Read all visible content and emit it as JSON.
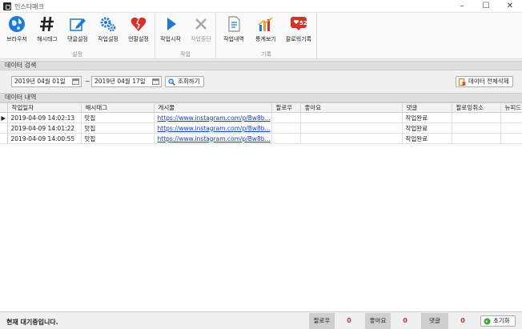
{
  "window": {
    "title": "인스타매크",
    "minimize": "–",
    "maximize": "☐",
    "close": "✕"
  },
  "ribbon": {
    "groups": [
      {
        "label": "설정",
        "buttons": [
          "브라우저",
          "해시태그",
          "댓글설정",
          "작업설정",
          "언팔설정"
        ]
      },
      {
        "label": "작업",
        "buttons": [
          "작업시작",
          "작업중단"
        ]
      },
      {
        "label": "기록",
        "buttons": [
          "작업내역",
          "통계보기",
          "팔로워기록"
        ]
      }
    ],
    "follower_badge": "52"
  },
  "search": {
    "title": "데이터 검색",
    "start_date": "2019년 04월 01일",
    "end_date": "2019년 04월 17일",
    "separator": "~",
    "search_button": "조회하기",
    "delete_all_button": "데이터 전체삭제"
  },
  "history": {
    "title": "데이터 내역",
    "columns": [
      "작업일자",
      "해시태그",
      "게시물",
      "팔로우",
      "좋아요",
      "댓글",
      "팔로잉취소",
      "뉴피드좋아요"
    ],
    "rows": [
      [
        "2019-04-09 14:02:13",
        "맛집",
        "https://www.instagram.com/p/Bw8b...",
        "",
        "",
        "작업완료",
        "",
        ""
      ],
      [
        "2019-04-09 14:01:22",
        "맛집",
        "https://www.instagram.com/p/Bw8b...",
        "",
        "",
        "작업완료",
        "",
        ""
      ],
      [
        "2019-04-09 14:00:55",
        "맛집",
        "https://www.instagram.com/p/Bw8b...",
        "",
        "",
        "작업완료",
        "",
        ""
      ]
    ],
    "current_row_marker": "▶"
  },
  "status": {
    "message": "현재 대기중입니다.",
    "follow_label": "팔로우",
    "follow_count": "0",
    "like_label": "좋아요",
    "like_count": "0",
    "comment_label": "댓글",
    "comment_count": "0",
    "reset_button": "초기화"
  },
  "colors": {
    "accent_blue": "#1f7ad1",
    "heart_red": "#d9302b",
    "link": "#1a3cb5",
    "count": "#c0392b"
  }
}
